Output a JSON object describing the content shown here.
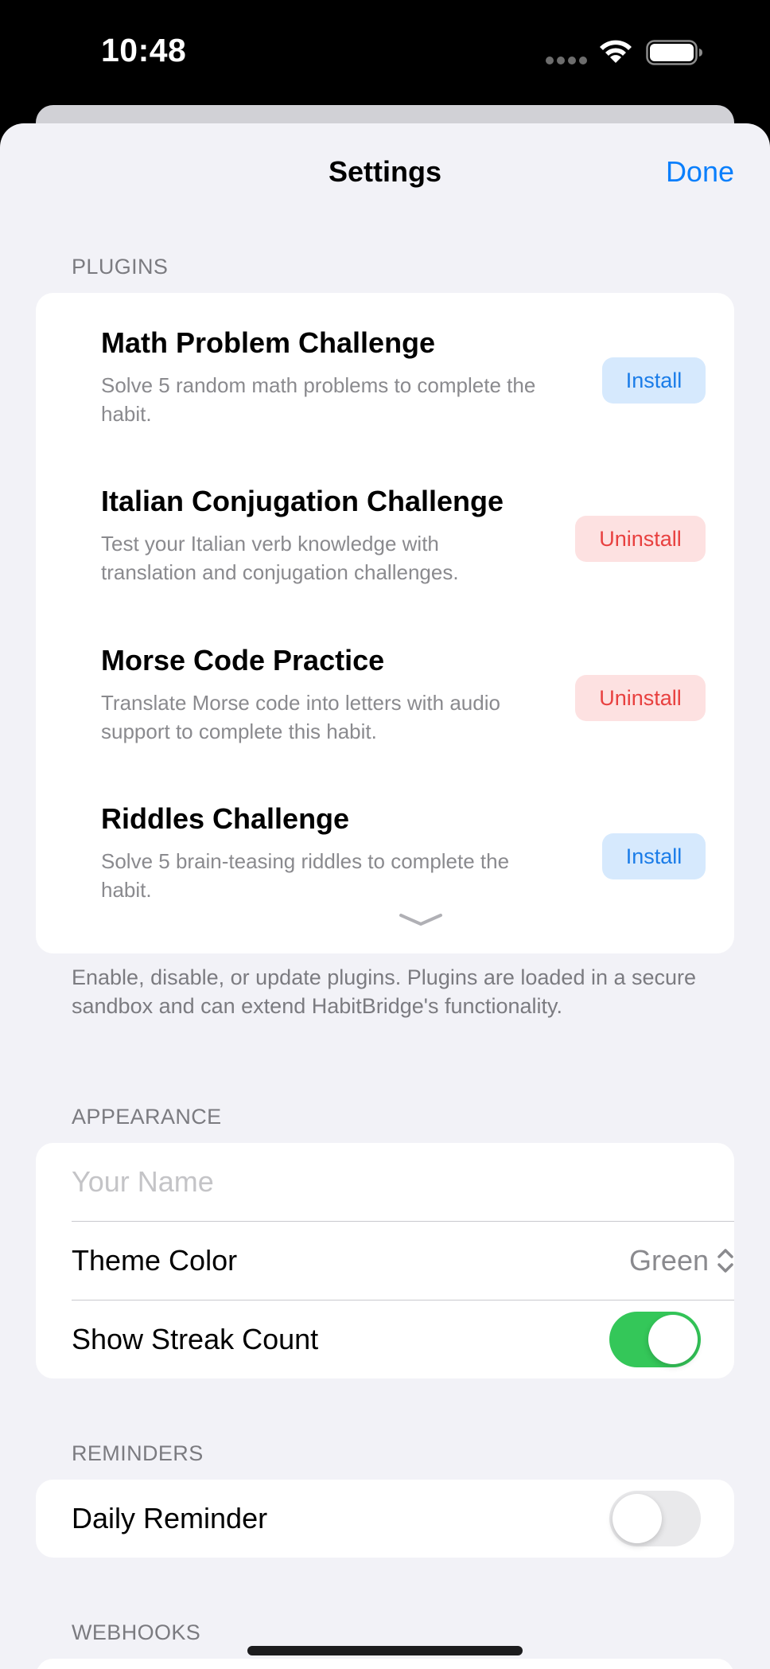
{
  "status_bar": {
    "time": "10:48"
  },
  "nav": {
    "title": "Settings",
    "done_label": "Done"
  },
  "plugins": {
    "header": "PLUGINS",
    "items": [
      {
        "title": "Math Problem Challenge",
        "description": "Solve 5 random math problems to complete the habit.",
        "action": "Install"
      },
      {
        "title": "Italian Conjugation Challenge",
        "description": "Test your Italian verb knowledge with translation and conjugation challenges.",
        "action": "Uninstall"
      },
      {
        "title": "Morse Code Practice",
        "description": "Translate Morse code into letters with audio support to complete this habit.",
        "action": "Uninstall"
      },
      {
        "title": "Riddles Challenge",
        "description": "Solve 5 brain-teasing riddles to complete the habit.",
        "action": "Install"
      }
    ],
    "footer": "Enable, disable, or update plugins. Plugins are loaded in a secure sandbox and can extend HabitBridge's functionality."
  },
  "appearance": {
    "header": "APPEARANCE",
    "name_placeholder": "Your Name",
    "name_value": "",
    "theme_label": "Theme Color",
    "theme_value": "Green",
    "streak_label": "Show Streak Count",
    "streak_on": true
  },
  "reminders": {
    "header": "REMINDERS",
    "daily_label": "Daily Reminder",
    "daily_on": false
  },
  "webhooks": {
    "header": "WEBHOOKS"
  },
  "colors": {
    "accent": "#0a7ffc",
    "toggle_on": "#34c759",
    "install_bg": "#d6e9fd",
    "uninstall_bg": "#fde1e1",
    "uninstall_text": "#e8403f"
  }
}
